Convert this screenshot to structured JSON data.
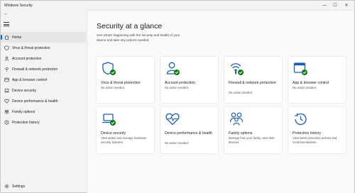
{
  "app": {
    "title": "Windows Security"
  },
  "window_controls": {
    "minimize": "—",
    "maximize": "☐",
    "close": "✕"
  },
  "back_label": "←",
  "sidebar": {
    "items": [
      {
        "label": "Home",
        "icon": "home-icon"
      },
      {
        "label": "Virus & threat protection",
        "icon": "shield-icon"
      },
      {
        "label": "Account protection",
        "icon": "person-icon"
      },
      {
        "label": "Firewall & network protection",
        "icon": "wifi-icon"
      },
      {
        "label": "App & browser control",
        "icon": "app-window-icon"
      },
      {
        "label": "Device security",
        "icon": "laptop-icon"
      },
      {
        "label": "Device performance & health",
        "icon": "heart-icon"
      },
      {
        "label": "Family options",
        "icon": "family-icon"
      },
      {
        "label": "Protection history",
        "icon": "history-icon"
      }
    ],
    "settings_label": "Settings"
  },
  "main": {
    "title": "Security at a glance",
    "subtitle": "See what's happening with the security and health of your device and take any actions needed.",
    "cards": [
      {
        "title": "Virus & threat protection",
        "desc": "No action needed.",
        "icon": "shield-check-icon"
      },
      {
        "title": "Account protection",
        "desc": "No action needed.",
        "icon": "person-check-icon"
      },
      {
        "title": "Firewall & network protection",
        "desc": "No action needed.",
        "icon": "wifi-check-icon"
      },
      {
        "title": "App & browser control",
        "desc": "No action needed.",
        "icon": "app-window-check-icon"
      },
      {
        "title": "Device security",
        "desc": "View status and manage hardware security features.",
        "icon": "laptop-check-icon"
      },
      {
        "title": "Device performance & health",
        "desc": "No action needed.",
        "icon": "heart-pulse-icon"
      },
      {
        "title": "Family options",
        "desc": "Manage how your family uses their devices.",
        "icon": "family-icon"
      },
      {
        "title": "Protection history",
        "desc": "View latest protection actions and recommendations.",
        "icon": "history-icon"
      }
    ]
  },
  "colors": {
    "accent": "#0067c0",
    "ok": "#107c10",
    "icon": "#1a5fb4"
  }
}
